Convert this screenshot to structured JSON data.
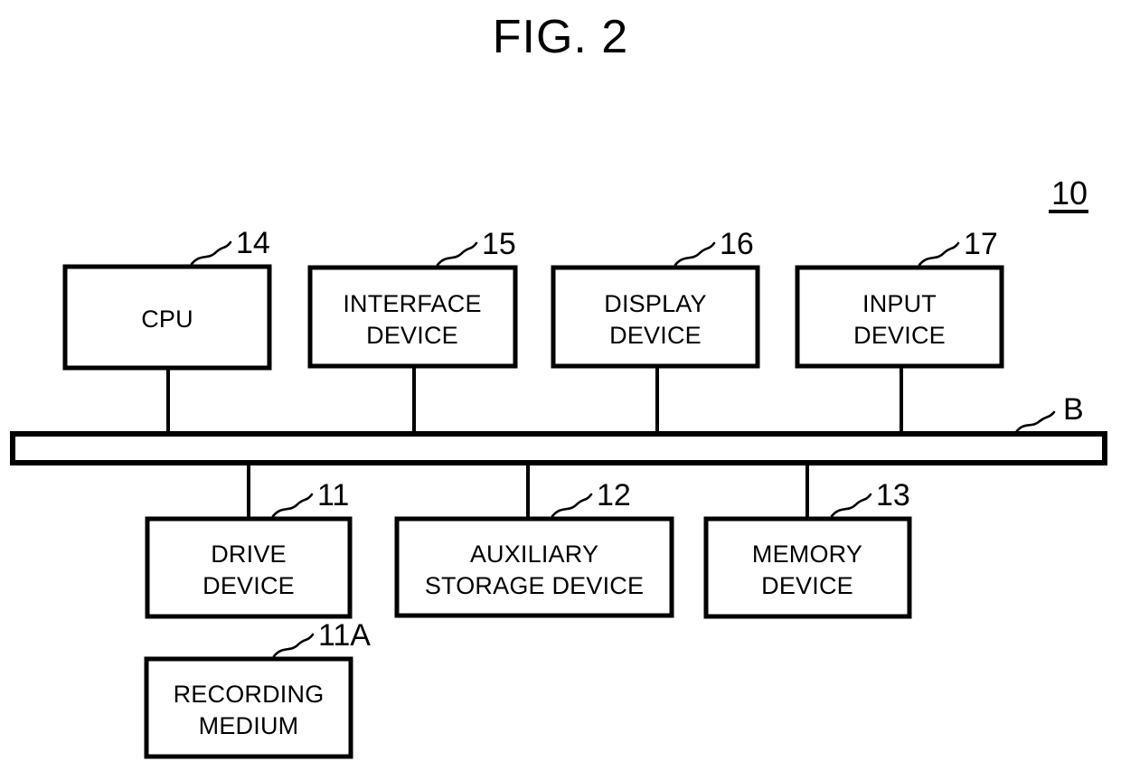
{
  "figure": {
    "title": "FIG. 2",
    "system_ref": "10",
    "bus_ref": "B"
  },
  "top_row": [
    {
      "ref": "14",
      "line1": "CPU",
      "line2": ""
    },
    {
      "ref": "15",
      "line1": "INTERFACE",
      "line2": "DEVICE"
    },
    {
      "ref": "16",
      "line1": "DISPLAY",
      "line2": "DEVICE"
    },
    {
      "ref": "17",
      "line1": "INPUT",
      "line2": "DEVICE"
    }
  ],
  "bottom_row": [
    {
      "ref": "11",
      "line1": "DRIVE",
      "line2": "DEVICE"
    },
    {
      "ref": "12",
      "line1": "AUXILIARY",
      "line2": "STORAGE DEVICE"
    },
    {
      "ref": "13",
      "line1": "MEMORY",
      "line2": "DEVICE"
    }
  ],
  "detached": [
    {
      "ref": "11A",
      "line1": "RECORDING",
      "line2": "MEDIUM"
    }
  ],
  "colors": {
    "ink": "#000000",
    "paper": "#ffffff"
  }
}
